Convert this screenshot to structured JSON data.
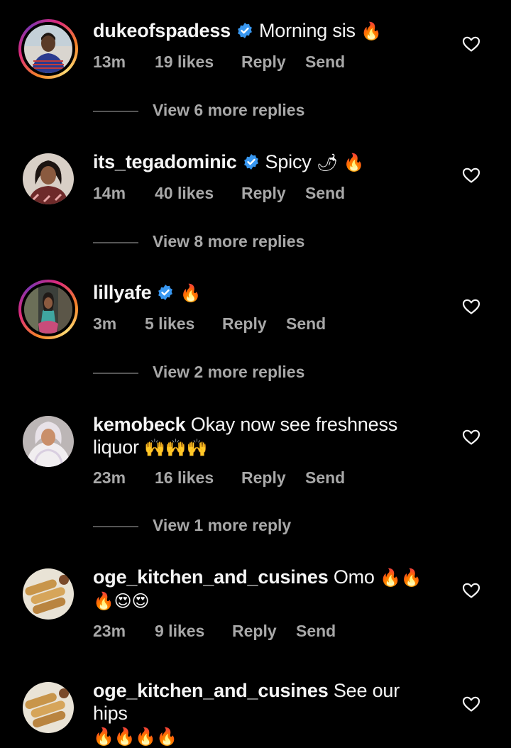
{
  "comments": [
    {
      "username": "dukeofspadess",
      "verified": true,
      "text": "Morning sis",
      "text_cont": "",
      "emojis": "🔥",
      "emojis_cont": "",
      "time": "13m",
      "likes": "19 likes",
      "reply": "Reply",
      "send": "Send",
      "view_more": "View 6 more replies",
      "has_story_ring": true
    },
    {
      "username": "its_tegadominic",
      "verified": true,
      "text": "Spicy",
      "text_cont": "",
      "emojis": "🌶 🔥",
      "emojis_cont": "",
      "time": "14m",
      "likes": "40 likes",
      "reply": "Reply",
      "send": "Send",
      "view_more": "View 8 more replies",
      "has_story_ring": false
    },
    {
      "username": "lillyafe",
      "verified": true,
      "text": "",
      "text_cont": "",
      "emojis": "🔥",
      "emojis_cont": "",
      "time": "3m",
      "likes": "5 likes",
      "reply": "Reply",
      "send": "Send",
      "view_more": "View 2 more replies",
      "has_story_ring": true
    },
    {
      "username": "kemobeck",
      "verified": false,
      "text": "Okay now see freshness",
      "text_cont": "liquor",
      "emojis": "",
      "emojis_cont": "🙌🙌🙌",
      "time": "23m",
      "likes": "16 likes",
      "reply": "Reply",
      "send": "Send",
      "view_more": "View 1 more reply",
      "has_story_ring": false
    },
    {
      "username": "oge_kitchen_and_cusines",
      "verified": false,
      "text": "Omo",
      "text_cont": "",
      "emojis": "🔥🔥",
      "emojis_cont": "🔥😍😍",
      "time": "23m",
      "likes": "9 likes",
      "reply": "Reply",
      "send": "Send",
      "view_more": "",
      "has_story_ring": false
    },
    {
      "username": "oge_kitchen_and_cusines",
      "verified": false,
      "text": "See our hips",
      "text_cont": "",
      "emojis": "",
      "emojis_cont": "🔥🔥🔥🔥",
      "time": "",
      "likes": "",
      "reply": "",
      "send": "",
      "view_more": "",
      "has_story_ring": false
    }
  ],
  "icons": {
    "verified": "verified-badge-icon",
    "like": "heart-outline-icon"
  },
  "colors": {
    "background": "#000000",
    "text_primary": "#f5f5f5",
    "text_secondary": "#a8a8a8",
    "verified_blue": "#3897f0"
  }
}
